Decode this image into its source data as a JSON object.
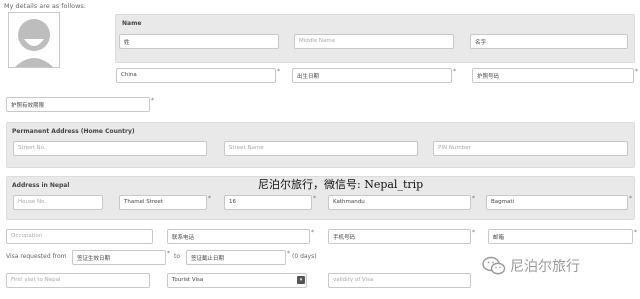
{
  "intro": "My details are as follows:",
  "name_section": {
    "title": "Name",
    "surname": "姓",
    "middle_name_placeholder": "Middle Name",
    "given_name": "名字"
  },
  "personal": {
    "nationality": "China",
    "birth_date": "出生日期",
    "passport_number": "护照号码",
    "passport_expiry": "护照有效期限"
  },
  "permanent_address": {
    "title": "Permanent Address (Home Country)",
    "street_no_placeholder": "Street No.",
    "street_name_placeholder": "Street Name",
    "pin_placeholder": "PIN Number"
  },
  "nepal_address": {
    "title": "Address in Nepal",
    "house_no_placeholder": "House No.",
    "street": "Thamel Street",
    "ward": "16",
    "city": "Kathmandu",
    "zone": "Bagmati"
  },
  "contact": {
    "occupation_placeholder": "Occupation",
    "phone": "联系电话",
    "mobile": "手机号码",
    "email": "邮箱"
  },
  "visa": {
    "requested_from_label": "Visa requested from",
    "from_date": "签证生效日期",
    "to_label": "to",
    "to_date": "签证截止日期",
    "days": "(0 days)"
  },
  "visit": {
    "first_visit_placeholder": "First visit to Nepal",
    "visa_type": "Tourist Visa",
    "validity_placeholder": "validity of Visa"
  },
  "required_mark": "*",
  "select_arrow": "▾",
  "watermark": "尼泊尔旅行，微信号: Nepal_trip",
  "brand": "尼泊尔旅行"
}
